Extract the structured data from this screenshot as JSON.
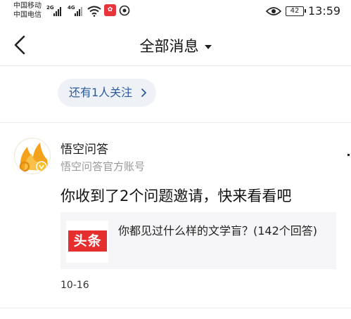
{
  "status_bar": {
    "carrier_1": "中国移动",
    "carrier_2": "中国电信",
    "net_1": "2G",
    "net_2": "4G",
    "battery": "42",
    "time": "13:59"
  },
  "header": {
    "title": "全部消息",
    "back_icon": "chevron-left-icon",
    "dropdown_icon": "caret-down-icon"
  },
  "follow_pill": {
    "label": "还有1人关注",
    "icon": "chevron-right-icon"
  },
  "message": {
    "sender": "悟空问答",
    "sender_sub": "悟空问答官方账号",
    "text": "你收到了2个问题邀请，快来看看吧",
    "card": {
      "logo_text": "头条",
      "title": "你都见过什么样的文学盲？(142个回答)"
    },
    "date": "10-16"
  },
  "colors": {
    "link_blue": "#2c5aa0",
    "pill_bg": "#eef1f6",
    "logo_red": "#e52e2e",
    "card_bg": "#f5f5f7"
  }
}
